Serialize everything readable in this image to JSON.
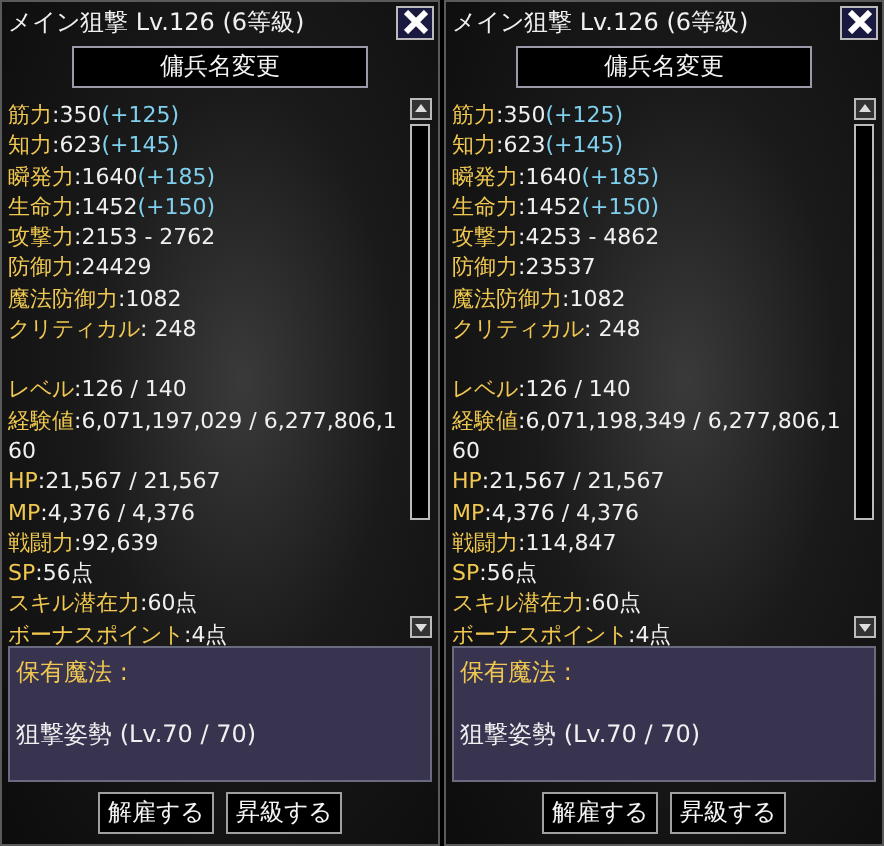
{
  "panels": [
    {
      "title": "メイン狙撃 Lv.126 (6等級)",
      "rename_button": "傭兵名変更",
      "attributes": [
        {
          "label": "筋力",
          "value": ":350",
          "bonus": "(+125)"
        },
        {
          "label": "知力",
          "value": ":623",
          "bonus": "(+145)"
        },
        {
          "label": "瞬発力",
          "value": ":1640",
          "bonus": "(+185)"
        },
        {
          "label": "生命力",
          "value": ":1452",
          "bonus": "(+150)"
        },
        {
          "label": "攻撃力",
          "value": ":2153 - 2762"
        },
        {
          "label": "防御力",
          "value": ":24429"
        },
        {
          "label": "魔法防御力",
          "value": ":1082"
        },
        {
          "label": "クリティカル",
          "value": ": 248"
        }
      ],
      "status": [
        {
          "label": "レベル",
          "value": ":126 / 140"
        },
        {
          "label": "経験値",
          "value": ":6,071,197,029 / 6,277,806,160"
        },
        {
          "label": "HP",
          "value": ":21,567 / 21,567"
        },
        {
          "label": "MP",
          "value": ":4,376 / 4,376"
        },
        {
          "label": "戦闘力",
          "value": ":92,639"
        },
        {
          "label": "SP",
          "value": ":56点"
        },
        {
          "label": "スキル潜在力",
          "value": ":60点"
        },
        {
          "label": "ボーナスポイント",
          "value": ":4点"
        }
      ],
      "magic": {
        "heading": "保有魔法 :",
        "skills": [
          "狙撃姿勢 (Lv.70 / 70)"
        ]
      },
      "buttons": [
        "解雇する",
        "昇級する"
      ]
    },
    {
      "title": "メイン狙撃 Lv.126 (6等級)",
      "rename_button": "傭兵名変更",
      "attributes": [
        {
          "label": "筋力",
          "value": ":350",
          "bonus": "(+125)"
        },
        {
          "label": "知力",
          "value": ":623",
          "bonus": "(+145)"
        },
        {
          "label": "瞬発力",
          "value": ":1640",
          "bonus": "(+185)"
        },
        {
          "label": "生命力",
          "value": ":1452",
          "bonus": "(+150)"
        },
        {
          "label": "攻撃力",
          "value": ":4253 - 4862"
        },
        {
          "label": "防御力",
          "value": ":23537"
        },
        {
          "label": "魔法防御力",
          "value": ":1082"
        },
        {
          "label": "クリティカル",
          "value": ": 248"
        }
      ],
      "status": [
        {
          "label": "レベル",
          "value": ":126 / 140"
        },
        {
          "label": "経験値",
          "value": ":6,071,198,349 / 6,277,806,160"
        },
        {
          "label": "HP",
          "value": ":21,567 / 21,567"
        },
        {
          "label": "MP",
          "value": ":4,376 / 4,376"
        },
        {
          "label": "戦闘力",
          "value": ":114,847"
        },
        {
          "label": "SP",
          "value": ":56点"
        },
        {
          "label": "スキル潜在力",
          "value": ":60点"
        },
        {
          "label": "ボーナスポイント",
          "value": ":4点"
        }
      ],
      "magic": {
        "heading": "保有魔法 :",
        "skills": [
          "狙撃姿勢 (Lv.70 / 70)"
        ]
      },
      "buttons": [
        "解雇する",
        "昇級する"
      ]
    }
  ]
}
